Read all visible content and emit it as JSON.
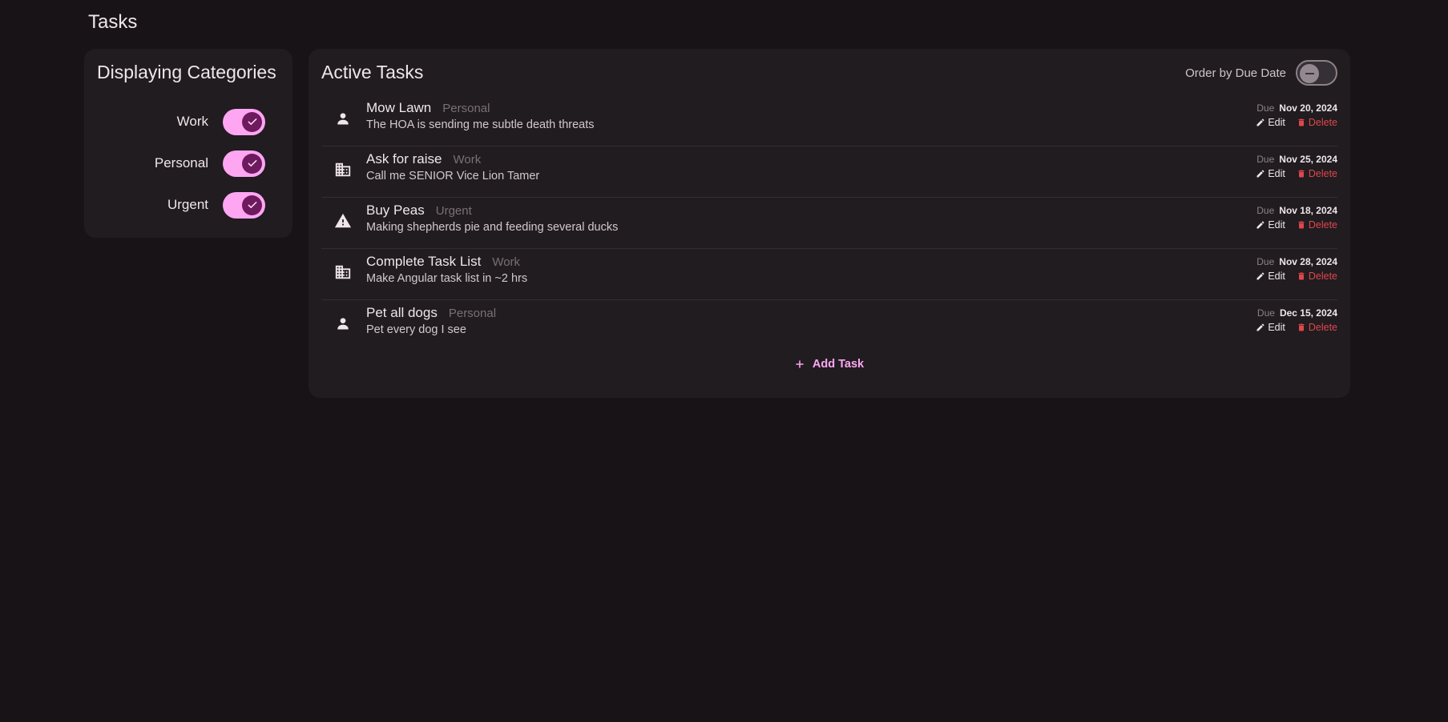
{
  "app": {
    "title": "Tasks"
  },
  "categories_panel": {
    "title": "Displaying Categories",
    "items": [
      {
        "label": "Work",
        "enabled": true
      },
      {
        "label": "Personal",
        "enabled": true
      },
      {
        "label": "Urgent",
        "enabled": true
      }
    ]
  },
  "tasks_panel": {
    "title": "Active Tasks",
    "order_label": "Order by Due Date",
    "order_enabled": false,
    "due_word": "Due",
    "edit_label": "Edit",
    "delete_label": "Delete",
    "add_label": "Add Task",
    "tasks": [
      {
        "name": "Mow Lawn",
        "category": "Personal",
        "icon": "person-icon",
        "description": "The HOA is sending me subtle death threats",
        "due": "Nov 20, 2024"
      },
      {
        "name": "Ask for raise",
        "category": "Work",
        "icon": "building-icon",
        "description": "Call me SENIOR Vice Lion Tamer",
        "due": "Nov 25, 2024"
      },
      {
        "name": "Buy Peas",
        "category": "Urgent",
        "icon": "warning-icon",
        "description": "Making shepherds pie and feeding several ducks",
        "due": "Nov 18, 2024"
      },
      {
        "name": "Complete Task List",
        "category": "Work",
        "icon": "building-icon",
        "description": "Make Angular task list in ~2 hrs",
        "due": "Nov 28, 2024"
      },
      {
        "name": "Pet all dogs",
        "category": "Personal",
        "icon": "person-icon",
        "description": "Pet every dog I see",
        "due": "Dec 15, 2024"
      }
    ]
  },
  "colors": {
    "background": "#171317",
    "card": "#201c20",
    "accent": "#ffa6f3",
    "accent_dark": "#6e1a5e",
    "danger": "#e0464b"
  }
}
